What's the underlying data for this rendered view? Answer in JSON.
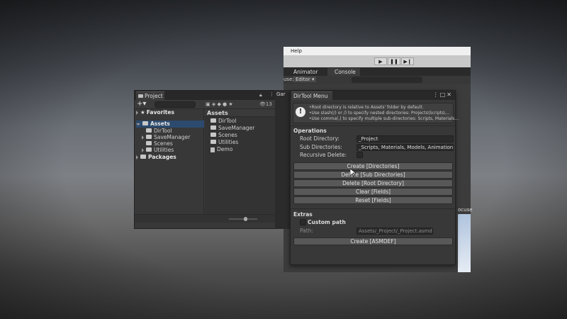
{
  "editor": {
    "help_menu": "Help",
    "tabs": [
      "Animator",
      "Console"
    ],
    "field_fragment": "use:",
    "editor_dropdown": "Editor ▾",
    "partial_scene_label": "ocuse"
  },
  "project": {
    "tab": "Project",
    "counter": "13",
    "tree": {
      "favorites": "Favorites",
      "assets": "Assets",
      "children": [
        "DirTool",
        "SaveManager",
        "Scenes",
        "Utilities"
      ],
      "packages": "Packages"
    },
    "grid": {
      "header": "Assets",
      "items": [
        "DirTool",
        "SaveManager",
        "Scenes",
        "Utilities",
        "Demo"
      ]
    },
    "scene_tab_fragment": "Gar"
  },
  "dirtool": {
    "tab": "DirTool Menu",
    "help": [
      "•Root directory is relative to Assets' folder by default.",
      "•Use slash(/) or /) to specify nested directories: Projects\\Scripts\\...",
      "•Use comma(,) to specify multiple sub-directories: Scripts, Materials..."
    ],
    "operations": {
      "title": "Operations",
      "root_label": "Root Directory:",
      "root_value": "_Project",
      "sub_label": "Sub Directories:",
      "sub_value": "_Scripts, Materials, Models, Animations, P",
      "recursive_label": "Recursive Delete:",
      "recursive_checked": false
    },
    "buttons": [
      "Create [Directories]",
      "Delete [Sub Directories]",
      "Delete [Root Directory]",
      "Clear [Fields]",
      "Reset [Fields]"
    ],
    "extras": {
      "title": "Extras",
      "custom_path_label": "Custom path",
      "custom_path_checked": false,
      "path_label": "Path:",
      "path_value": "Assets/_Project/_Project.asmdef",
      "create_button": "Create [ASMDEF]"
    }
  }
}
